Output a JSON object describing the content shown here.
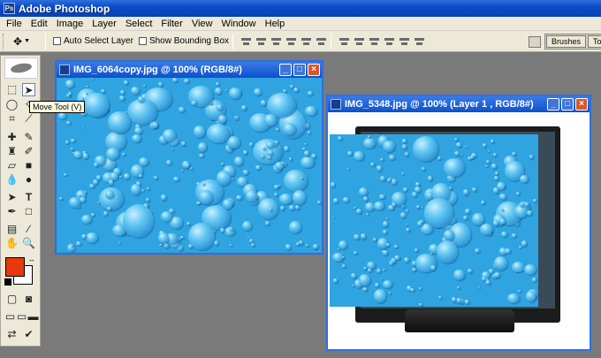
{
  "app": {
    "title": "Adobe Photoshop",
    "icon": "photoshop-icon"
  },
  "menu": [
    "File",
    "Edit",
    "Image",
    "Layer",
    "Select",
    "Filter",
    "View",
    "Window",
    "Help"
  ],
  "options": {
    "auto_select_label": "Auto Select Layer",
    "show_bbox_label": "Show Bounding Box",
    "palette_tabs": [
      "Brushes",
      "To"
    ]
  },
  "toolbox": {
    "tooltip": "Move Tool (V)",
    "foreground_color": "#e8380d",
    "background_color": "#ffffff"
  },
  "documents": [
    {
      "title": "IMG_6064copy.jpg @ 100% (RGB/8#)"
    },
    {
      "title": "IMG_5348.jpg @ 100% (Layer 1 , RGB/8#)"
    }
  ],
  "colors": {
    "accent": "#0a4cc8",
    "water": "#2fa4e0",
    "workspace": "#7a7a7a"
  }
}
